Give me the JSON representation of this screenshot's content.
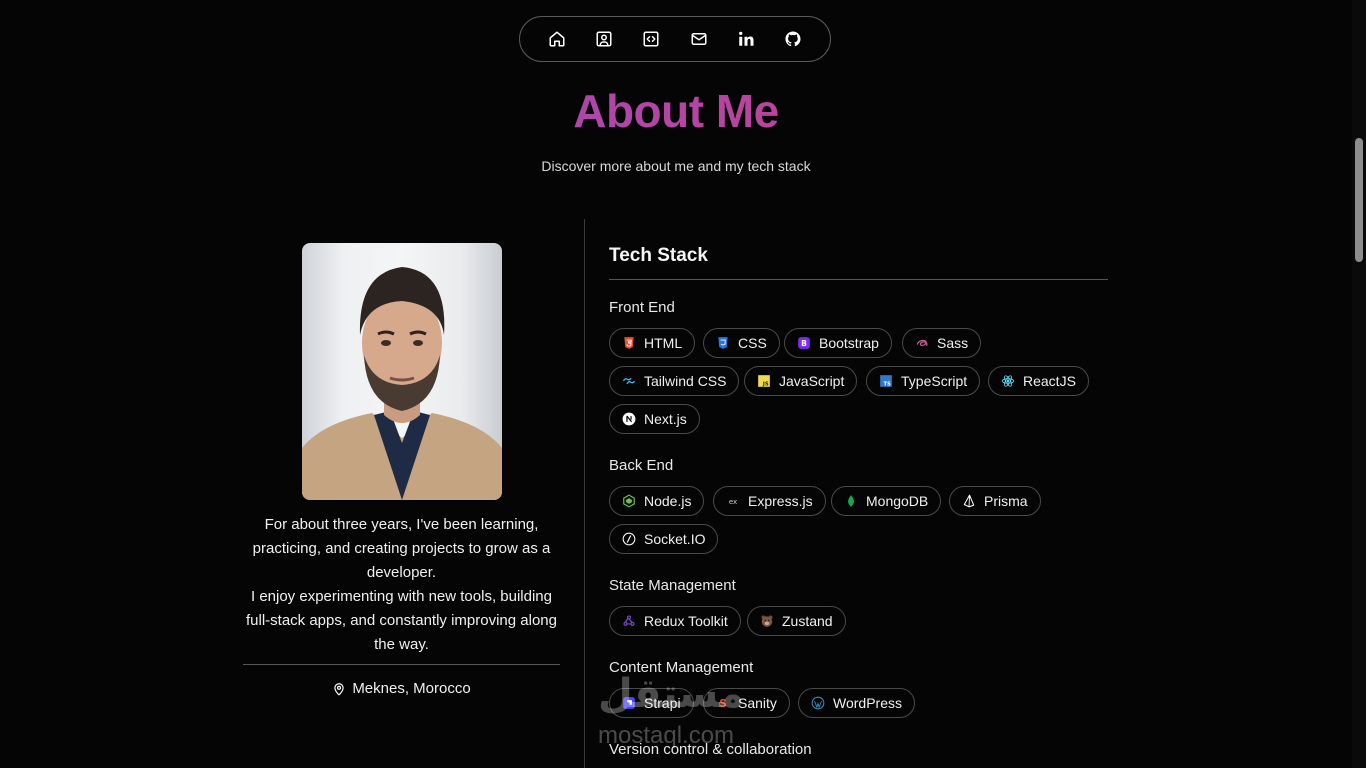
{
  "nav": {
    "items": [
      {
        "name": "nav-home-button",
        "icon": "home-icon"
      },
      {
        "name": "nav-about-button",
        "icon": "user-square-icon"
      },
      {
        "name": "nav-projects-button",
        "icon": "code-icon"
      },
      {
        "name": "nav-contact-button",
        "icon": "mail-icon"
      },
      {
        "name": "nav-linkedin-button",
        "icon": "linkedin-icon"
      },
      {
        "name": "nav-github-button",
        "icon": "github-icon"
      }
    ]
  },
  "header": {
    "title": "About Me",
    "subtitle": "Discover more about me and my tech stack",
    "title_gradient": [
      "#8a4fd6",
      "#e0458a"
    ]
  },
  "profile": {
    "photo_alt": "profile-photo",
    "bio_paragraphs": [
      "For about three years, I've been learning, practicing, and creating projects to grow as a developer.",
      "I enjoy experimenting with new tools, building full-stack apps, and constantly improving along the way."
    ],
    "location": "Meknes, Morocco",
    "location_icon": "map-pin-icon"
  },
  "stack": {
    "title": "Tech Stack",
    "categories": [
      {
        "label": "Front End",
        "items": [
          {
            "label": "HTML",
            "icon": "html5-icon"
          },
          {
            "label": "CSS",
            "icon": "css3-icon"
          },
          {
            "label": "Bootstrap",
            "icon": "bootstrap-icon"
          },
          {
            "label": "Sass",
            "icon": "sass-icon"
          },
          {
            "label": "Tailwind CSS",
            "icon": "tailwind-icon"
          },
          {
            "label": "JavaScript",
            "icon": "javascript-icon"
          },
          {
            "label": "TypeScript",
            "icon": "typescript-icon"
          },
          {
            "label": "ReactJS",
            "icon": "react-icon"
          },
          {
            "label": "Next.js",
            "icon": "nextjs-icon"
          }
        ]
      },
      {
        "label": "Back End",
        "items": [
          {
            "label": "Node.js",
            "icon": "nodejs-icon"
          },
          {
            "label": "Express.js",
            "icon": "express-icon"
          },
          {
            "label": "MongoDB",
            "icon": "mongodb-icon"
          },
          {
            "label": "Prisma",
            "icon": "prisma-icon"
          },
          {
            "label": "Socket.IO",
            "icon": "socketio-icon"
          }
        ]
      },
      {
        "label": "State Management",
        "items": [
          {
            "label": "Redux Toolkit",
            "icon": "redux-icon"
          },
          {
            "label": "Zustand",
            "icon": "zustand-icon"
          }
        ]
      },
      {
        "label": "Content Management",
        "items": [
          {
            "label": "Strapi",
            "icon": "strapi-icon"
          },
          {
            "label": "Sanity",
            "icon": "sanity-icon"
          },
          {
            "label": "WordPress",
            "icon": "wordpress-icon"
          }
        ]
      },
      {
        "label": "Version control & collaboration",
        "items": []
      }
    ]
  },
  "watermark": {
    "arabic": "مستقل",
    "latin": "mostaql.com"
  }
}
